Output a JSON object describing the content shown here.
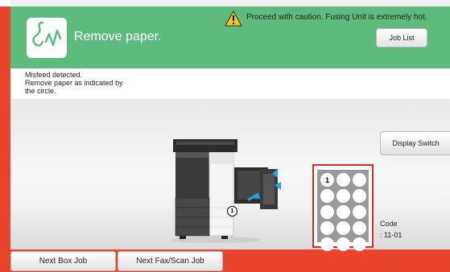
{
  "header": {
    "title": "Remove paper.",
    "icon": "paper-jam-icon",
    "color": "#5dbb7d"
  },
  "warning": {
    "icon": "warning-triangle-icon",
    "text": "Proceed with caution. Fusing Unit is extremely hot."
  },
  "job_list_label": "Job List",
  "message": {
    "text": "Misfeed detected.\nRemove paper as indicated by\nthe circle."
  },
  "display_switch_label": "Display Switch",
  "illustration": {
    "callout_number": "1"
  },
  "tray_diagram": {
    "marked_number": "1",
    "rows": 5,
    "columns": 3
  },
  "code": {
    "label": "Code",
    "value": ": 11-01"
  },
  "footer": {
    "next_box_label": "Next Box Job",
    "next_fax_label": "Next Fax/Scan Job"
  },
  "colors": {
    "accent_red": "#e8452c",
    "header_green": "#5dbb7d",
    "highlight_red": "#d42a2a",
    "arrow_cyan": "#1ea7e0"
  }
}
